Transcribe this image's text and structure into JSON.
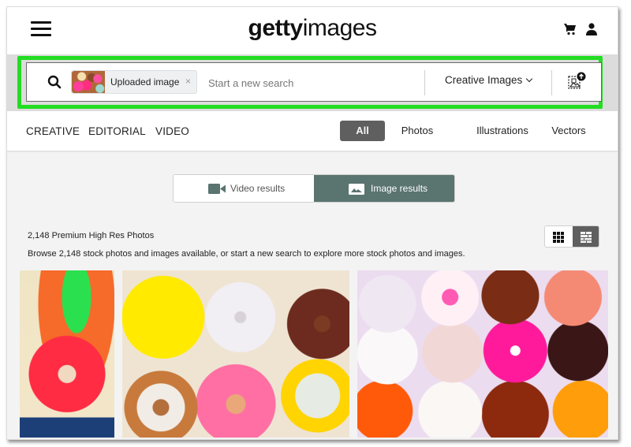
{
  "header": {
    "logo_bold": "getty",
    "logo_light": "images",
    "icons": [
      "hamburger-menu-icon",
      "cart-icon",
      "user-icon"
    ]
  },
  "search": {
    "chip_label": "Uploaded image",
    "chip_close": "×",
    "placeholder": "Start a new search",
    "value": "",
    "type_selected": "Creative Images",
    "highlight_color": "#22dd22"
  },
  "nav": {
    "links": [
      "CREATIVE",
      "EDITORIAL",
      "VIDEO"
    ],
    "filters": [
      {
        "label": "All",
        "active": true
      },
      {
        "label": "Photos",
        "active": false
      },
      {
        "label": "Illustrations",
        "active": false
      },
      {
        "label": "Vectors",
        "active": false
      }
    ]
  },
  "results_toggle": {
    "video_label": "Video results",
    "image_label": "Image results",
    "active": "image",
    "active_color": "#5a7470"
  },
  "results": {
    "count_text": "2,148 Premium High Res Photos",
    "browse_text": "Browse 2,148 stock photos and images available, or start a new search to explore more stock photos and images.",
    "view_modes": [
      "grid",
      "mosaic"
    ],
    "active_view": "mosaic",
    "images": [
      {
        "alt": "Donuts with green and pink frosting"
      },
      {
        "alt": "Assorted frosted donuts with sprinkles"
      },
      {
        "alt": "Rows of colorful glazed donuts"
      }
    ]
  }
}
